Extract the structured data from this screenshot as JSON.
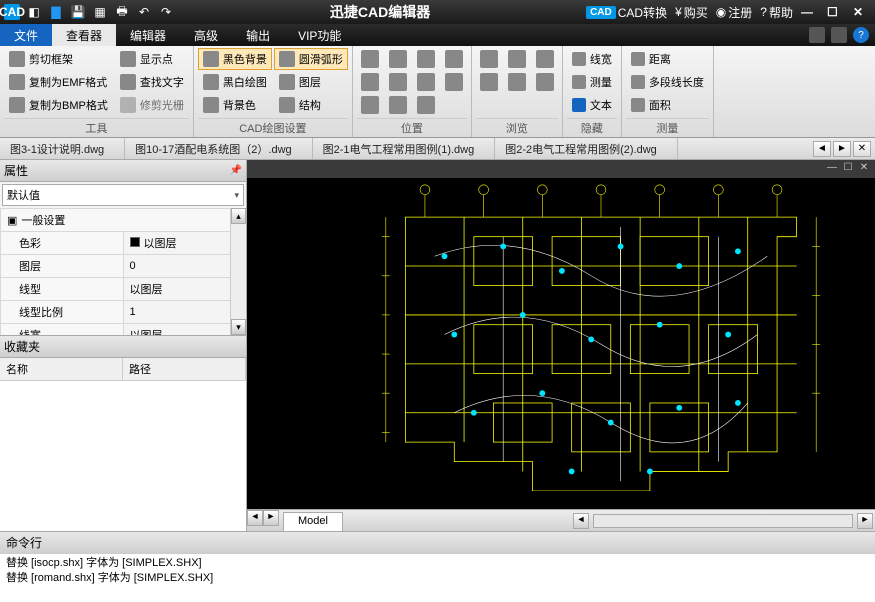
{
  "app": {
    "title": "迅捷CAD编辑器"
  },
  "titlebar": {
    "right": {
      "convert": "CAD转换",
      "buy": "购买",
      "register": "注册",
      "help": "帮助"
    }
  },
  "menu": {
    "file": "文件",
    "tabs": [
      "查看器",
      "编辑器",
      "高级",
      "输出",
      "VIP功能"
    ]
  },
  "ribbon": {
    "groups": {
      "tools": {
        "label": "工具",
        "items": [
          "剪切框架",
          "复制为EMF格式",
          "复制为BMP格式",
          "显示点",
          "查找文字",
          "修剪光栅"
        ]
      },
      "cad": {
        "label": "CAD绘图设置",
        "items": [
          "黑色背景",
          "黑白绘图",
          "背景色",
          "圆滑弧形",
          "图层",
          "结构"
        ]
      },
      "pos": {
        "label": "位置"
      },
      "browse": {
        "label": "浏览"
      },
      "hide": {
        "label": "隐藏",
        "items": [
          "线宽",
          "测量",
          "文本"
        ]
      },
      "measure": {
        "label": "测量",
        "items": [
          "距离",
          "多段线长度",
          "面积"
        ]
      }
    }
  },
  "docs": {
    "tabs": [
      "图3-1设计说明.dwg",
      "图10-17酒配电系统图（2）.dwg",
      "图2-1电气工程常用图例(1).dwg",
      "图2-2电气工程常用图例(2).dwg"
    ]
  },
  "props": {
    "title": "属性",
    "default": "默认值",
    "section": "一般设置",
    "rows": [
      {
        "k": "色彩",
        "v": "以图层"
      },
      {
        "k": "图层",
        "v": "0"
      },
      {
        "k": "线型",
        "v": "以图层"
      },
      {
        "k": "线型比例",
        "v": "1"
      },
      {
        "k": "线宽",
        "v": "以图层"
      }
    ]
  },
  "fav": {
    "title": "收藏夹",
    "cols": [
      "名称",
      "路径"
    ]
  },
  "model": {
    "tab": "Model"
  },
  "cmd": {
    "title": "命令行",
    "lines": [
      "替换 [isocp.shx] 字体为 [SIMPLEX.SHX]",
      "替换 [romand.shx] 字体为 [SIMPLEX.SHX]"
    ]
  }
}
